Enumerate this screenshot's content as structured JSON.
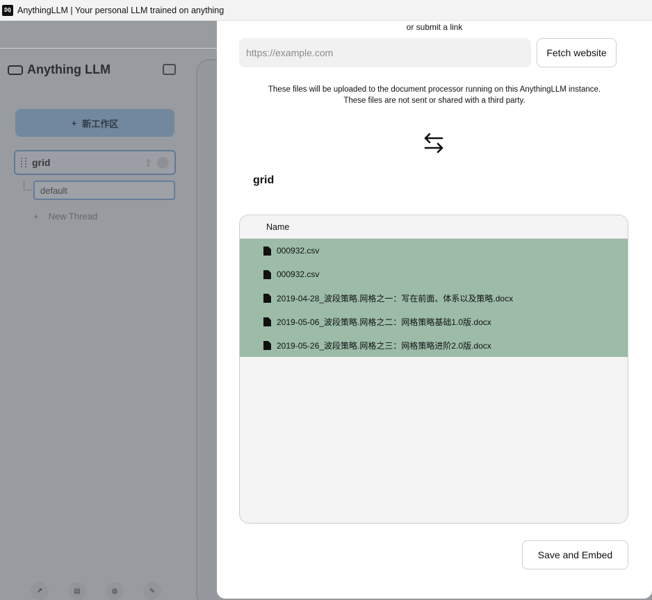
{
  "window": {
    "icon_text": "DQ",
    "title": "AnythingLLM | Your personal LLM trained on anything"
  },
  "sidebar": {
    "brand": "Anything LLM",
    "new_workspace_label": "新工作区",
    "workspace": {
      "name": "grid",
      "thread": "default"
    },
    "new_thread_label": "New Thread",
    "footer_icons": [
      "link-icon",
      "docs-icon",
      "community-icon",
      "settings-wrench-icon"
    ]
  },
  "modal": {
    "submit_link_label": "or submit a link",
    "url_input": {
      "placeholder": "https://example.com",
      "value": ""
    },
    "fetch_button_label": "Fetch website",
    "note_line1": "These files will be uploaded to the document processor running on this AnythingLLM instance.",
    "note_line2": "These files are not sent or shared with a third party.",
    "swap_icon": "arrows-swap-icon",
    "workspace_title": "grid",
    "table": {
      "column_name": "Name",
      "rows": [
        "000932.csv",
        "000932.csv",
        "2019-04-28_波段策略.网格之一：写在前面、体系以及策略.docx",
        "2019-05-06_波段策略.网格之二：网格策略基础1.0版.docx",
        "2019-05-26_波段策略.网格之三：网格策略进阶2.0版.docx"
      ],
      "row_highlight_color": "#9cbca8"
    },
    "save_button_label": "Save and Embed"
  }
}
